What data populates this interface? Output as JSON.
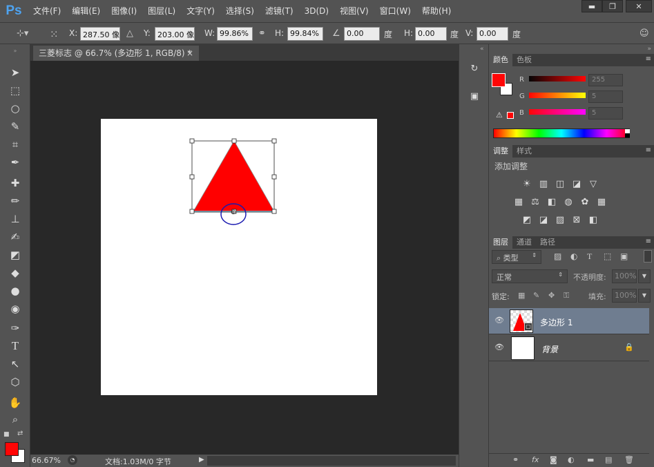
{
  "menubar": {
    "logo": "Ps",
    "items": [
      "文件(F)",
      "编辑(E)",
      "图像(I)",
      "图层(L)",
      "文字(Y)",
      "选择(S)",
      "滤镜(T)",
      "3D(D)",
      "视图(V)",
      "窗口(W)",
      "帮助(H)"
    ],
    "minimize": "▬",
    "restore": "❐",
    "close": "✕"
  },
  "options": {
    "x_label": "X:",
    "x_value": "287.50 像",
    "y_label": "Y:",
    "y_value": "203.00 像",
    "w_label": "W:",
    "w_value": "99.86%",
    "h_label": "H:",
    "h_value": "99.84%",
    "angle_value": "0.00",
    "angle_unit": "度",
    "hskew_label": "H:",
    "hskew_value": "0.00",
    "hskew_unit": "度",
    "vskew_label": "V:",
    "vskew_value": "0.00",
    "vskew_unit": "度"
  },
  "document": {
    "tab_title": "三菱标志 @ 66.7% (多边形 1, RGB/8) *",
    "tab_close": "×",
    "zoom": "66.67%",
    "doc_info": "文档:1.03M/0 字节",
    "shape_color": "#ff0000"
  },
  "color_panel": {
    "tabs": [
      "颜色",
      "色板"
    ],
    "r_label": "R",
    "r_value": "255",
    "g_label": "G",
    "g_value": "5",
    "b_label": "B",
    "b_value": "5",
    "foreground": "#ff0505",
    "background": "#ffffff"
  },
  "adjust_panel": {
    "tabs": [
      "调整",
      "样式"
    ],
    "title": "添加调整"
  },
  "layers_panel": {
    "tabs": [
      "图层",
      "通道",
      "路径"
    ],
    "filter_label": "类型",
    "blend_mode": "正常",
    "opacity_label": "不透明度:",
    "opacity_value": "100%",
    "lock_label": "锁定:",
    "fill_label": "填充:",
    "fill_value": "100%",
    "layers": [
      {
        "name": "多边形 1"
      },
      {
        "name": "背景"
      }
    ]
  }
}
